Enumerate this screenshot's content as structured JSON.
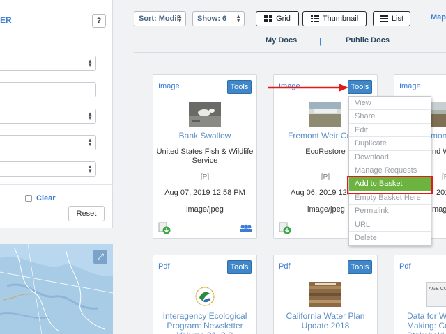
{
  "left_panel": {
    "title": "ER",
    "help_label": "?",
    "clear_label": "Clear",
    "reset_label": "Reset"
  },
  "toolbar": {
    "sort_value": "Sort: Modifi",
    "show_value": "Show: 6",
    "grid_label": "Grid",
    "thumbnail_label": "Thumbnail",
    "list_label": "List",
    "map_label": "Map"
  },
  "doc_tabs": {
    "my_docs": "My Docs",
    "separator": "|",
    "public_docs": "Public Docs"
  },
  "cards": [
    {
      "type": "Image",
      "tools": "Tools",
      "title": "Bank Swallow",
      "owner": "United States Fish & Wildlife Service",
      "flag": "[P]",
      "date": "Aug 07, 2019 12:58 PM",
      "mime": "image/jpeg"
    },
    {
      "type": "Image",
      "tools": "Tools",
      "title": "Fremont Weir Cres",
      "owner": "EcoRestore",
      "flag": "[P]",
      "date": "Aug 06, 2019 12:59",
      "mime": "image/jpeg"
    },
    {
      "type": "Image",
      "title": "mont",
      "owner": "nd W",
      "flag": "[F",
      "date": "201",
      "mime": "mage"
    },
    {
      "type": "Pdf",
      "tools": "Tools",
      "title": "Interagency Ecological Program: Newsletter Volume 31, 2-3"
    },
    {
      "type": "Pdf",
      "tools": "Tools",
      "title": "California Water Plan Update 2018"
    },
    {
      "type": "Pdf",
      "title": "Data for Wa Making: Cor Stakehold",
      "thumb_text": "AGE CO"
    }
  ],
  "tools_menu": {
    "items": [
      "View",
      "Share",
      "Edit",
      "Duplicate",
      "Download",
      "Manage Requests",
      "Add to Basket",
      "Empty Basket Here",
      "Permalink",
      "URL",
      "Delete"
    ],
    "active_index": 6
  },
  "colors": {
    "accent": "#3a7bd5",
    "tools_button": "#3f87c9",
    "menu_active": "#6cb33f",
    "annotation": "#e01b1b"
  }
}
